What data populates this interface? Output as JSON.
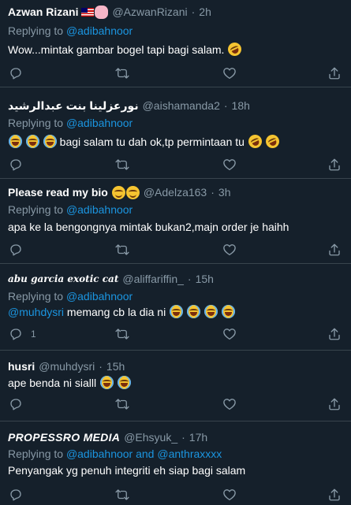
{
  "tweets": [
    {
      "name": "Azwan Rizani",
      "handle": "@AzwanRizani",
      "time": "2h",
      "replying_prefix": "Replying to",
      "replying_to": "@adibahnoor",
      "text": "Wow...mintak gambar bogel tapi bagi salam.",
      "reply_count": ""
    },
    {
      "name": "نورعزلينا بنت عبدالرشيد",
      "handle": "@aishamanda2",
      "time": "18h",
      "replying_prefix": "Replying to",
      "replying_to": "@adibahnoor",
      "text": "bagi salam tu dah ok,tp permintaan tu",
      "reply_count": ""
    },
    {
      "name": "Please read my bio",
      "handle": "@Adelza163",
      "time": "3h",
      "replying_prefix": "Replying to",
      "replying_to": "@adibahnoor",
      "text": "apa ke la bengongnya mintak bukan2,majn order je haihh",
      "reply_count": ""
    },
    {
      "name": "abu garcia exotic cat",
      "handle": "@aliffariffin_",
      "time": "15h",
      "replying_prefix": "Replying to",
      "replying_to": "@adibahnoor",
      "mention": "@muhdysri",
      "text": "memang cb la dia ni",
      "reply_count": "1"
    },
    {
      "name": "husri",
      "handle": "@muhdysri",
      "time": "15h",
      "text": "ape benda ni sialll",
      "reply_count": ""
    },
    {
      "name": "PROPESSRO MEDIA",
      "handle": "@Ehsyuk_",
      "time": "17h",
      "replying_prefix": "Replying to",
      "replying_to": "@adibahnoor",
      "replying_and": "and",
      "replying_to_2": "@anthraxxxx",
      "text": "Penyangak yg penuh integriti eh siap bagi salam",
      "reply_count": ""
    }
  ],
  "dot": "·",
  "icons": {
    "reply": "reply-icon",
    "retweet": "retweet-icon",
    "like": "heart-icon",
    "share": "share-icon"
  },
  "colors": {
    "background": "#15202b",
    "divider": "#38444d",
    "secondary_text": "#8899a6",
    "link": "#1b95e0"
  }
}
